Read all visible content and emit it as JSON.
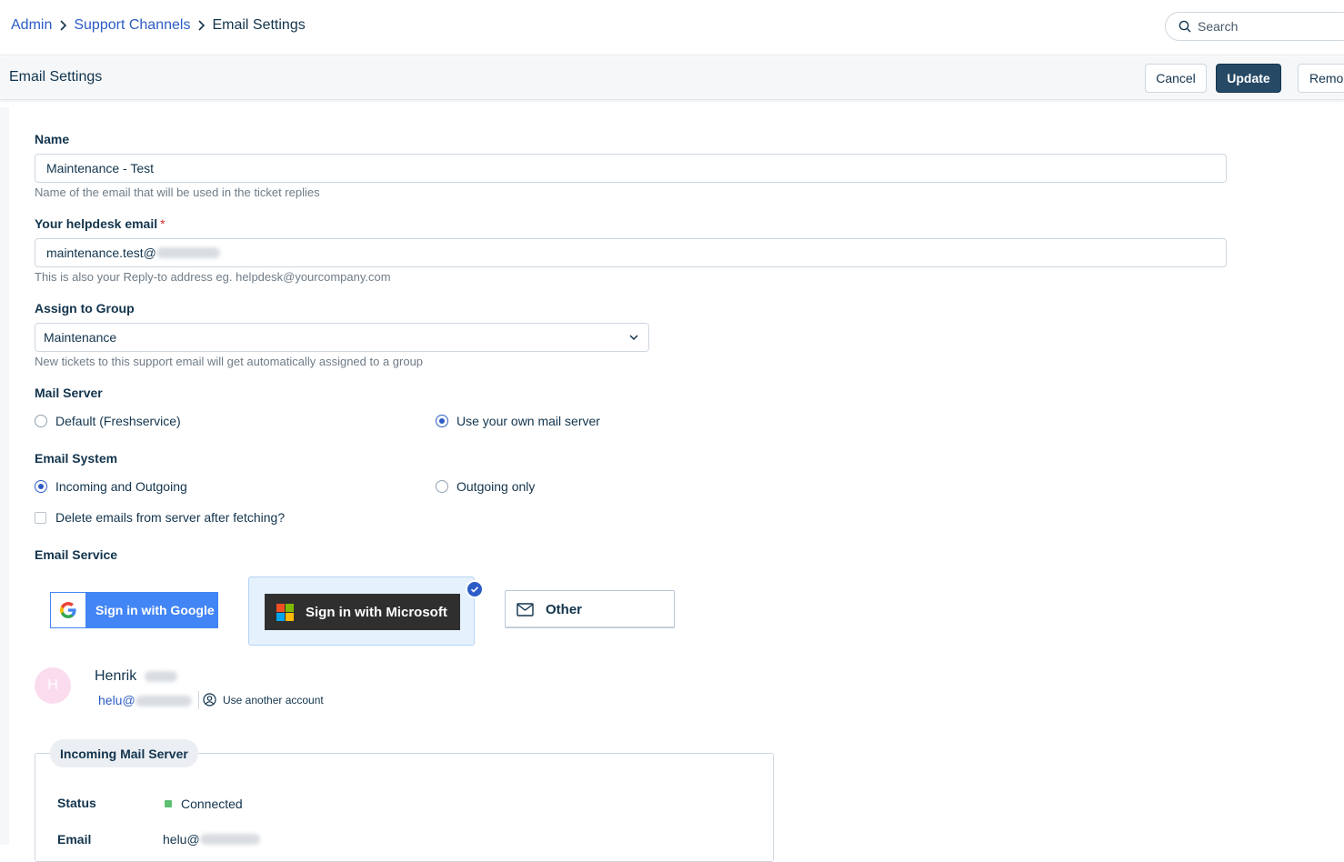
{
  "breadcrumb": {
    "items": [
      "Admin",
      "Support Channels"
    ],
    "current": "Email Settings"
  },
  "search": {
    "placeholder": "Search"
  },
  "header": {
    "title": "Email Settings",
    "cancel": "Cancel",
    "update": "Update",
    "remove": "Remo"
  },
  "form": {
    "name": {
      "label": "Name",
      "value": "Maintenance - Test",
      "hint": "Name of the email that will be used in the ticket replies"
    },
    "helpdesk_email": {
      "label": "Your helpdesk email",
      "required": "*",
      "value": "maintenance.test@",
      "hint": "This is also your Reply-to address eg. helpdesk@yourcompany.com"
    },
    "group": {
      "label": "Assign to Group",
      "value": "Maintenance",
      "hint": "New tickets to this support email will get automatically assigned to a group"
    },
    "mail_server": {
      "label": "Mail Server",
      "options": [
        "Default (Freshservice)",
        "Use your own mail server"
      ],
      "selected": 1
    },
    "email_system": {
      "label": "Email System",
      "options": [
        "Incoming and Outgoing",
        "Outgoing only"
      ],
      "selected": 0
    },
    "delete_after_fetch": {
      "label": "Delete emails from server after fetching?",
      "checked": false
    },
    "email_service": {
      "label": "Email Service",
      "google": "Sign in with Google",
      "microsoft": "Sign in with Microsoft",
      "other": "Other",
      "selected": "microsoft"
    }
  },
  "account": {
    "initial": "H",
    "name": "Henrik",
    "email": "helu@",
    "use_another": "Use another account"
  },
  "incoming": {
    "legend": "Incoming Mail Server",
    "status_label": "Status",
    "status_value": "Connected",
    "email_label": "Email",
    "email_value": "helu@"
  },
  "colors": {
    "primary": "#264966",
    "link": "#2c5cc5",
    "google": "#4285f4",
    "microsoft": "#2f2f2f",
    "success": "#5ebf74"
  }
}
